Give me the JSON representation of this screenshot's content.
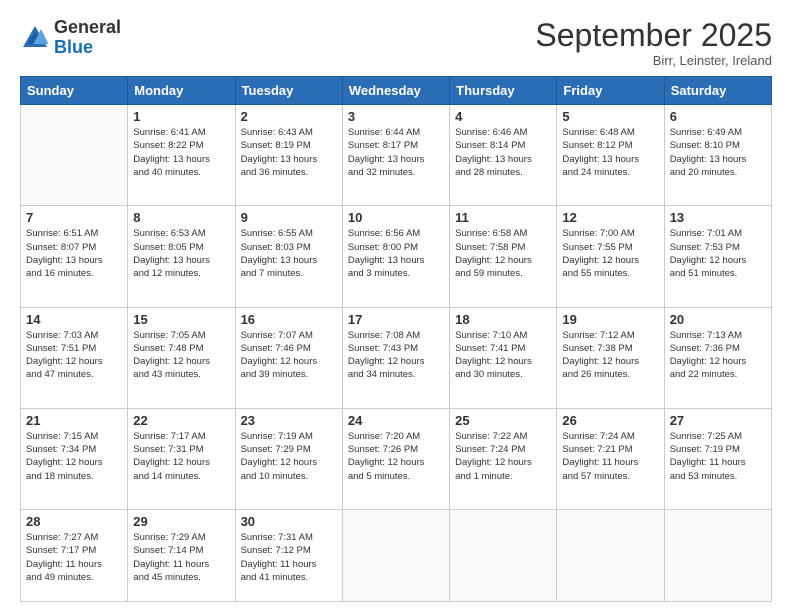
{
  "header": {
    "logo_general": "General",
    "logo_blue": "Blue",
    "month": "September 2025",
    "location": "Birr, Leinster, Ireland"
  },
  "days_of_week": [
    "Sunday",
    "Monday",
    "Tuesday",
    "Wednesday",
    "Thursday",
    "Friday",
    "Saturday"
  ],
  "weeks": [
    [
      {
        "day": "",
        "info": ""
      },
      {
        "day": "1",
        "info": "Sunrise: 6:41 AM\nSunset: 8:22 PM\nDaylight: 13 hours\nand 40 minutes."
      },
      {
        "day": "2",
        "info": "Sunrise: 6:43 AM\nSunset: 8:19 PM\nDaylight: 13 hours\nand 36 minutes."
      },
      {
        "day": "3",
        "info": "Sunrise: 6:44 AM\nSunset: 8:17 PM\nDaylight: 13 hours\nand 32 minutes."
      },
      {
        "day": "4",
        "info": "Sunrise: 6:46 AM\nSunset: 8:14 PM\nDaylight: 13 hours\nand 28 minutes."
      },
      {
        "day": "5",
        "info": "Sunrise: 6:48 AM\nSunset: 8:12 PM\nDaylight: 13 hours\nand 24 minutes."
      },
      {
        "day": "6",
        "info": "Sunrise: 6:49 AM\nSunset: 8:10 PM\nDaylight: 13 hours\nand 20 minutes."
      }
    ],
    [
      {
        "day": "7",
        "info": "Sunrise: 6:51 AM\nSunset: 8:07 PM\nDaylight: 13 hours\nand 16 minutes."
      },
      {
        "day": "8",
        "info": "Sunrise: 6:53 AM\nSunset: 8:05 PM\nDaylight: 13 hours\nand 12 minutes."
      },
      {
        "day": "9",
        "info": "Sunrise: 6:55 AM\nSunset: 8:03 PM\nDaylight: 13 hours\nand 7 minutes."
      },
      {
        "day": "10",
        "info": "Sunrise: 6:56 AM\nSunset: 8:00 PM\nDaylight: 13 hours\nand 3 minutes."
      },
      {
        "day": "11",
        "info": "Sunrise: 6:58 AM\nSunset: 7:58 PM\nDaylight: 12 hours\nand 59 minutes."
      },
      {
        "day": "12",
        "info": "Sunrise: 7:00 AM\nSunset: 7:55 PM\nDaylight: 12 hours\nand 55 minutes."
      },
      {
        "day": "13",
        "info": "Sunrise: 7:01 AM\nSunset: 7:53 PM\nDaylight: 12 hours\nand 51 minutes."
      }
    ],
    [
      {
        "day": "14",
        "info": "Sunrise: 7:03 AM\nSunset: 7:51 PM\nDaylight: 12 hours\nand 47 minutes."
      },
      {
        "day": "15",
        "info": "Sunrise: 7:05 AM\nSunset: 7:48 PM\nDaylight: 12 hours\nand 43 minutes."
      },
      {
        "day": "16",
        "info": "Sunrise: 7:07 AM\nSunset: 7:46 PM\nDaylight: 12 hours\nand 39 minutes."
      },
      {
        "day": "17",
        "info": "Sunrise: 7:08 AM\nSunset: 7:43 PM\nDaylight: 12 hours\nand 34 minutes."
      },
      {
        "day": "18",
        "info": "Sunrise: 7:10 AM\nSunset: 7:41 PM\nDaylight: 12 hours\nand 30 minutes."
      },
      {
        "day": "19",
        "info": "Sunrise: 7:12 AM\nSunset: 7:38 PM\nDaylight: 12 hours\nand 26 minutes."
      },
      {
        "day": "20",
        "info": "Sunrise: 7:13 AM\nSunset: 7:36 PM\nDaylight: 12 hours\nand 22 minutes."
      }
    ],
    [
      {
        "day": "21",
        "info": "Sunrise: 7:15 AM\nSunset: 7:34 PM\nDaylight: 12 hours\nand 18 minutes."
      },
      {
        "day": "22",
        "info": "Sunrise: 7:17 AM\nSunset: 7:31 PM\nDaylight: 12 hours\nand 14 minutes."
      },
      {
        "day": "23",
        "info": "Sunrise: 7:19 AM\nSunset: 7:29 PM\nDaylight: 12 hours\nand 10 minutes."
      },
      {
        "day": "24",
        "info": "Sunrise: 7:20 AM\nSunset: 7:26 PM\nDaylight: 12 hours\nand 5 minutes."
      },
      {
        "day": "25",
        "info": "Sunrise: 7:22 AM\nSunset: 7:24 PM\nDaylight: 12 hours\nand 1 minute."
      },
      {
        "day": "26",
        "info": "Sunrise: 7:24 AM\nSunset: 7:21 PM\nDaylight: 11 hours\nand 57 minutes."
      },
      {
        "day": "27",
        "info": "Sunrise: 7:25 AM\nSunset: 7:19 PM\nDaylight: 11 hours\nand 53 minutes."
      }
    ],
    [
      {
        "day": "28",
        "info": "Sunrise: 7:27 AM\nSunset: 7:17 PM\nDaylight: 11 hours\nand 49 minutes."
      },
      {
        "day": "29",
        "info": "Sunrise: 7:29 AM\nSunset: 7:14 PM\nDaylight: 11 hours\nand 45 minutes."
      },
      {
        "day": "30",
        "info": "Sunrise: 7:31 AM\nSunset: 7:12 PM\nDaylight: 11 hours\nand 41 minutes."
      },
      {
        "day": "",
        "info": ""
      },
      {
        "day": "",
        "info": ""
      },
      {
        "day": "",
        "info": ""
      },
      {
        "day": "",
        "info": ""
      }
    ]
  ]
}
